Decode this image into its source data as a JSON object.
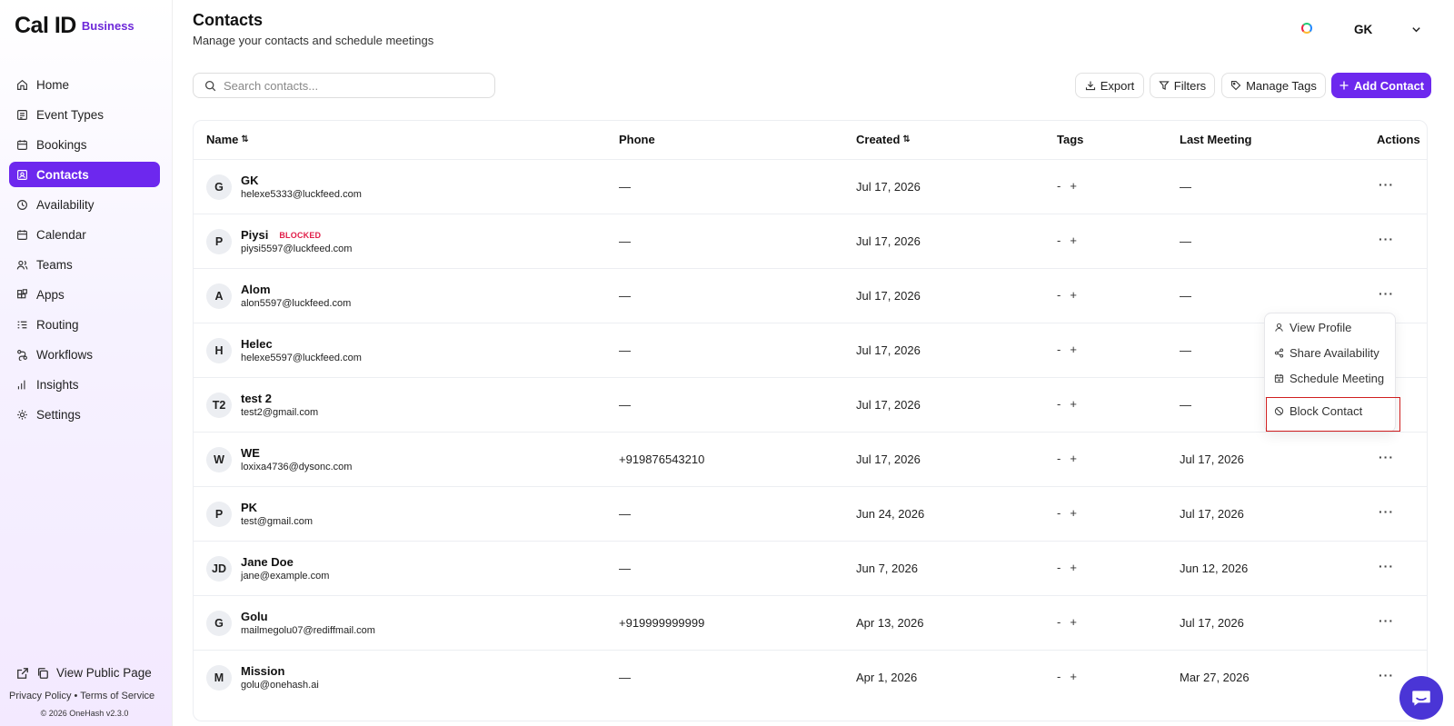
{
  "brand": {
    "name": "Cal ID",
    "tier": "Business"
  },
  "sidebar": {
    "items": [
      {
        "label": "Home",
        "icon": "home-icon",
        "active": false
      },
      {
        "label": "Event Types",
        "icon": "event-types-icon",
        "active": false
      },
      {
        "label": "Bookings",
        "icon": "calendar-icon",
        "active": false
      },
      {
        "label": "Contacts",
        "icon": "contacts-icon",
        "active": true
      },
      {
        "label": "Availability",
        "icon": "clock-icon",
        "active": false
      },
      {
        "label": "Calendar",
        "icon": "calendar-icon",
        "active": false
      },
      {
        "label": "Teams",
        "icon": "users-icon",
        "active": false
      },
      {
        "label": "Apps",
        "icon": "apps-icon",
        "active": false
      },
      {
        "label": "Routing",
        "icon": "routing-icon",
        "active": false
      },
      {
        "label": "Workflows",
        "icon": "workflows-icon",
        "active": false
      },
      {
        "label": "Insights",
        "icon": "chart-icon",
        "active": false
      },
      {
        "label": "Settings",
        "icon": "gear-icon",
        "active": false
      }
    ],
    "public_page": "View Public Page",
    "privacy": "Privacy Policy",
    "bullet": "•",
    "terms": "Terms of Service",
    "copyright": "© 2026 OneHash v2.3.0"
  },
  "header": {
    "title": "Contacts",
    "subtitle": "Manage your contacts and schedule meetings",
    "user": "GK"
  },
  "toolbar": {
    "search_placeholder": "Search contacts...",
    "export": "Export",
    "filters": "Filters",
    "manage_tags": "Manage Tags",
    "add_contact": "Add Contact"
  },
  "table": {
    "columns": {
      "name": "Name",
      "phone": "Phone",
      "created": "Created",
      "tags": "Tags",
      "last_meeting": "Last Meeting",
      "actions": "Actions"
    },
    "sort_glyph": "⇅",
    "rows": [
      {
        "initials": "G",
        "name": "GK",
        "email": "helexe5333@luckfeed.com",
        "blocked": "",
        "phone": "—",
        "created": "Jul 17, 2026",
        "tags_dash": "-",
        "tags_add": "+",
        "last_meeting": "—",
        "more": "···"
      },
      {
        "initials": "P",
        "name": "Piysi",
        "email": "piysi5597@luckfeed.com",
        "blocked": "BLOCKED",
        "phone": "—",
        "created": "Jul 17, 2026",
        "tags_dash": "-",
        "tags_add": "+",
        "last_meeting": "—",
        "more": "···"
      },
      {
        "initials": "A",
        "name": "Alom",
        "email": "alon5597@luckfeed.com",
        "blocked": "",
        "phone": "—",
        "created": "Jul 17, 2026",
        "tags_dash": "-",
        "tags_add": "+",
        "last_meeting": "—",
        "more": "···"
      },
      {
        "initials": "H",
        "name": "Helec",
        "email": "helexe5597@luckfeed.com",
        "blocked": "",
        "phone": "—",
        "created": "Jul 17, 2026",
        "tags_dash": "-",
        "tags_add": "+",
        "last_meeting": "—",
        "more": ""
      },
      {
        "initials": "T2",
        "name": "test 2",
        "email": "test2@gmail.com",
        "blocked": "",
        "phone": "—",
        "created": "Jul 17, 2026",
        "tags_dash": "-",
        "tags_add": "+",
        "last_meeting": "—",
        "more": ""
      },
      {
        "initials": "W",
        "name": "WE",
        "email": "loxixa4736@dysonc.com",
        "blocked": "",
        "phone": "+919876543210",
        "created": "Jul 17, 2026",
        "tags_dash": "-",
        "tags_add": "+",
        "last_meeting": "Jul 17, 2026",
        "more": "···"
      },
      {
        "initials": "P",
        "name": "PK",
        "email": "test@gmail.com",
        "blocked": "",
        "phone": "—",
        "created": "Jun 24, 2026",
        "tags_dash": "-",
        "tags_add": "+",
        "last_meeting": "Jul 17, 2026",
        "more": "···"
      },
      {
        "initials": "JD",
        "name": "Jane Doe",
        "email": "jane@example.com",
        "blocked": "",
        "phone": "—",
        "created": "Jun 7, 2026",
        "tags_dash": "-",
        "tags_add": "+",
        "last_meeting": "Jun 12, 2026",
        "more": "···"
      },
      {
        "initials": "G",
        "name": "Golu",
        "email": "mailmegolu07@rediffmail.com",
        "blocked": "",
        "phone": "+919999999999",
        "created": "Apr 13, 2026",
        "tags_dash": "-",
        "tags_add": "+",
        "last_meeting": "Jul 17, 2026",
        "more": "···"
      },
      {
        "initials": "M",
        "name": "Mission",
        "email": "golu@onehash.ai",
        "blocked": "",
        "phone": "—",
        "created": "Apr 1, 2026",
        "tags_dash": "-",
        "tags_add": "+",
        "last_meeting": "Mar 27, 2026",
        "more": "···"
      }
    ]
  },
  "actions_menu": {
    "view_profile": "View Profile",
    "share_availability": "Share Availability",
    "schedule_meeting": "Schedule Meeting",
    "block_contact": "Block Contact"
  },
  "colors": {
    "accent": "#6d28ee",
    "blocked": "#e11d48",
    "highlight": "#d01f1f",
    "chat": "#4a35d6"
  }
}
